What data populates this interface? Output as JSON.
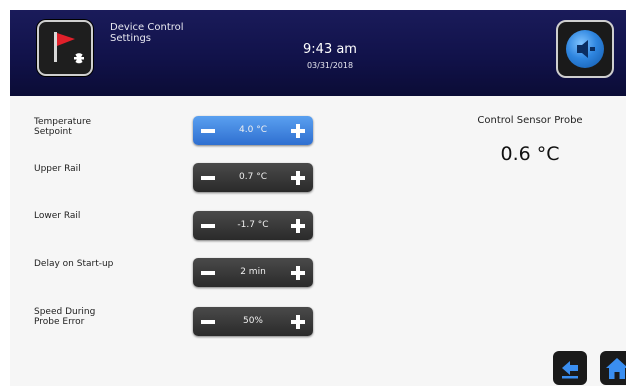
{
  "header": {
    "title": "Device Control\nSettings",
    "time": "9:43 am",
    "date": "03/31/2018",
    "alarm_icon": "alarm-flag-icon",
    "speaker_icon": "speaker-mute-icon"
  },
  "settings": [
    {
      "label": "Temperature\nSetpoint",
      "value": "4.0 °C",
      "active": true
    },
    {
      "label": "Upper Rail",
      "value": "0.7 °C",
      "active": false
    },
    {
      "label": "Lower Rail",
      "value": "-1.7 °C",
      "active": false
    },
    {
      "label": "Delay on Start-up",
      "value": "2 min",
      "active": false
    },
    {
      "label": "Speed During\nProbe Error",
      "value": "50%",
      "active": false
    }
  ],
  "sensor": {
    "title": "Control Sensor Probe",
    "value": "0.6 °C"
  },
  "nav": {
    "back_icon": "back-arrow-icon",
    "home_icon": "home-icon"
  },
  "colors": {
    "header_bg": "#11124a",
    "active_stepper": "#2f6fd0",
    "stepper": "#2a2a2a",
    "alarm_red": "#e0202a"
  }
}
